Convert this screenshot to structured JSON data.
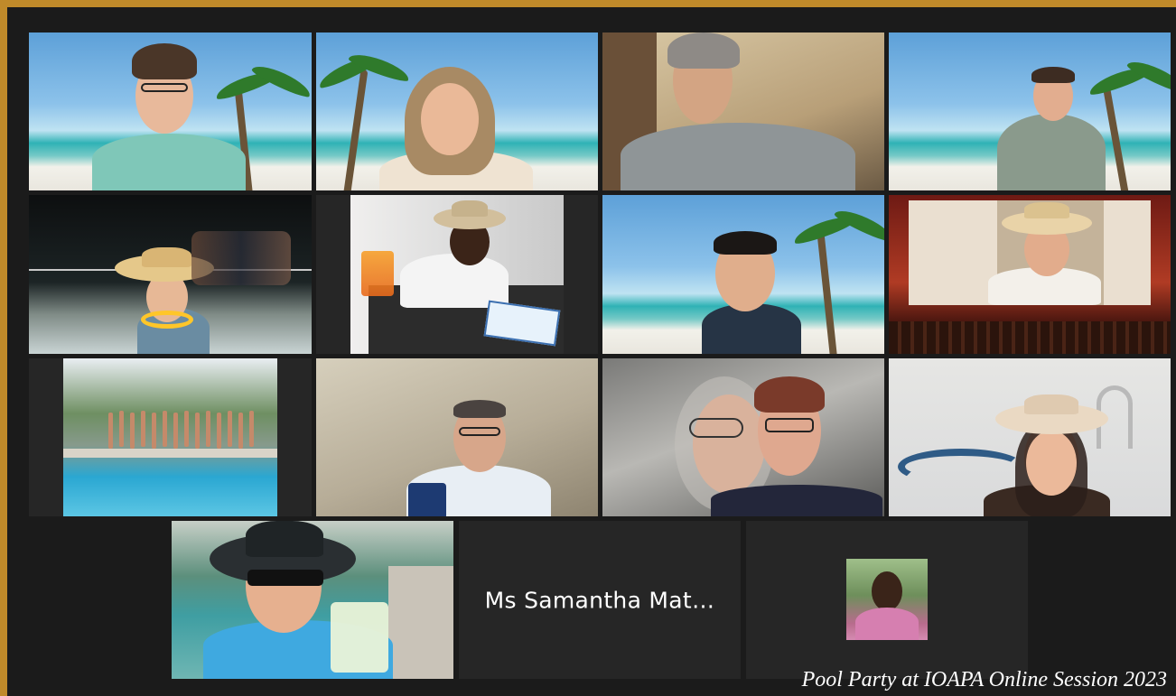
{
  "meeting": {
    "name_tile_label": "Ms Samantha Mat…",
    "caption": "Pool Party at IOAPA Online Session 2023",
    "active_speaker_color": "#3fc36a",
    "frame_color": "#c08a2a"
  },
  "participants": [
    {
      "tile": "video",
      "background": "beach"
    },
    {
      "tile": "video",
      "background": "beach"
    },
    {
      "tile": "video",
      "background": "room"
    },
    {
      "tile": "video",
      "background": "beach"
    },
    {
      "tile": "video",
      "background": "night-pool"
    },
    {
      "tile": "video",
      "background": "room"
    },
    {
      "tile": "video",
      "background": "beach"
    },
    {
      "tile": "video",
      "background": "theater"
    },
    {
      "tile": "video",
      "background": "pool"
    },
    {
      "tile": "video",
      "background": "office"
    },
    {
      "tile": "video",
      "background": "room",
      "active_speaker": true
    },
    {
      "tile": "video",
      "background": "sand"
    },
    {
      "tile": "video",
      "background": "pool"
    },
    {
      "tile": "name-only"
    },
    {
      "tile": "avatar-thumbnail"
    }
  ]
}
